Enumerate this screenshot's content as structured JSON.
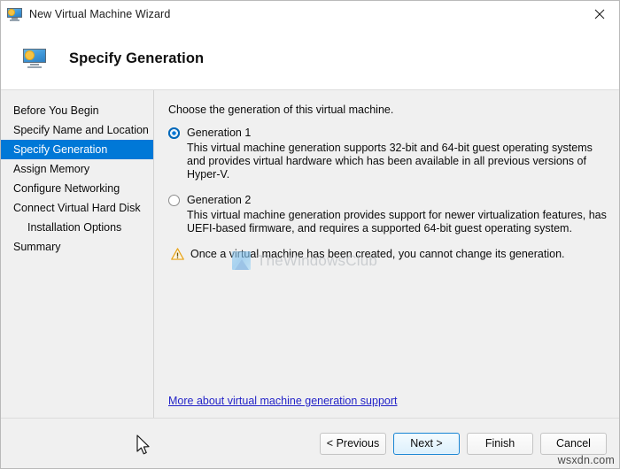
{
  "window": {
    "title": "New Virtual Machine Wizard",
    "title_icon": "virtual-machine-icon",
    "close_label": "✕"
  },
  "header": {
    "icon": "virtual-machine-icon",
    "title": "Specify Generation"
  },
  "sidebar": {
    "items": [
      {
        "label": "Before You Begin",
        "selected": false,
        "indent": false
      },
      {
        "label": "Specify Name and Location",
        "selected": false,
        "indent": false
      },
      {
        "label": "Specify Generation",
        "selected": true,
        "indent": false
      },
      {
        "label": "Assign Memory",
        "selected": false,
        "indent": false
      },
      {
        "label": "Configure Networking",
        "selected": false,
        "indent": false
      },
      {
        "label": "Connect Virtual Hard Disk",
        "selected": false,
        "indent": false
      },
      {
        "label": "Installation Options",
        "selected": false,
        "indent": true
      },
      {
        "label": "Summary",
        "selected": false,
        "indent": false
      }
    ],
    "selected_color": "#0078d7"
  },
  "main": {
    "intro": "Choose the generation of this virtual machine.",
    "options": [
      {
        "label": "Generation 1",
        "selected": true,
        "description": "This virtual machine generation supports 32-bit and 64-bit guest operating systems and provides virtual hardware which has been available in all previous versions of Hyper-V."
      },
      {
        "label": "Generation 2",
        "selected": false,
        "description": "This virtual machine generation provides support for newer virtualization features, has UEFI-based firmware, and requires a supported 64-bit guest operating system."
      }
    ],
    "warning": {
      "icon": "warning-triangle-icon",
      "text": "Once a virtual machine has been created, you cannot change its generation."
    },
    "watermark": {
      "icon": "thewindowsclub-logo-icon",
      "text": "TheWindowsClub"
    },
    "link": "More about virtual machine generation support"
  },
  "footer": {
    "buttons": [
      {
        "label": "< Previous",
        "default": false
      },
      {
        "label": "Next >",
        "default": true
      },
      {
        "label": "Finish",
        "default": false
      },
      {
        "label": "Cancel",
        "default": false
      }
    ],
    "watermark": "wsxdn.com"
  }
}
